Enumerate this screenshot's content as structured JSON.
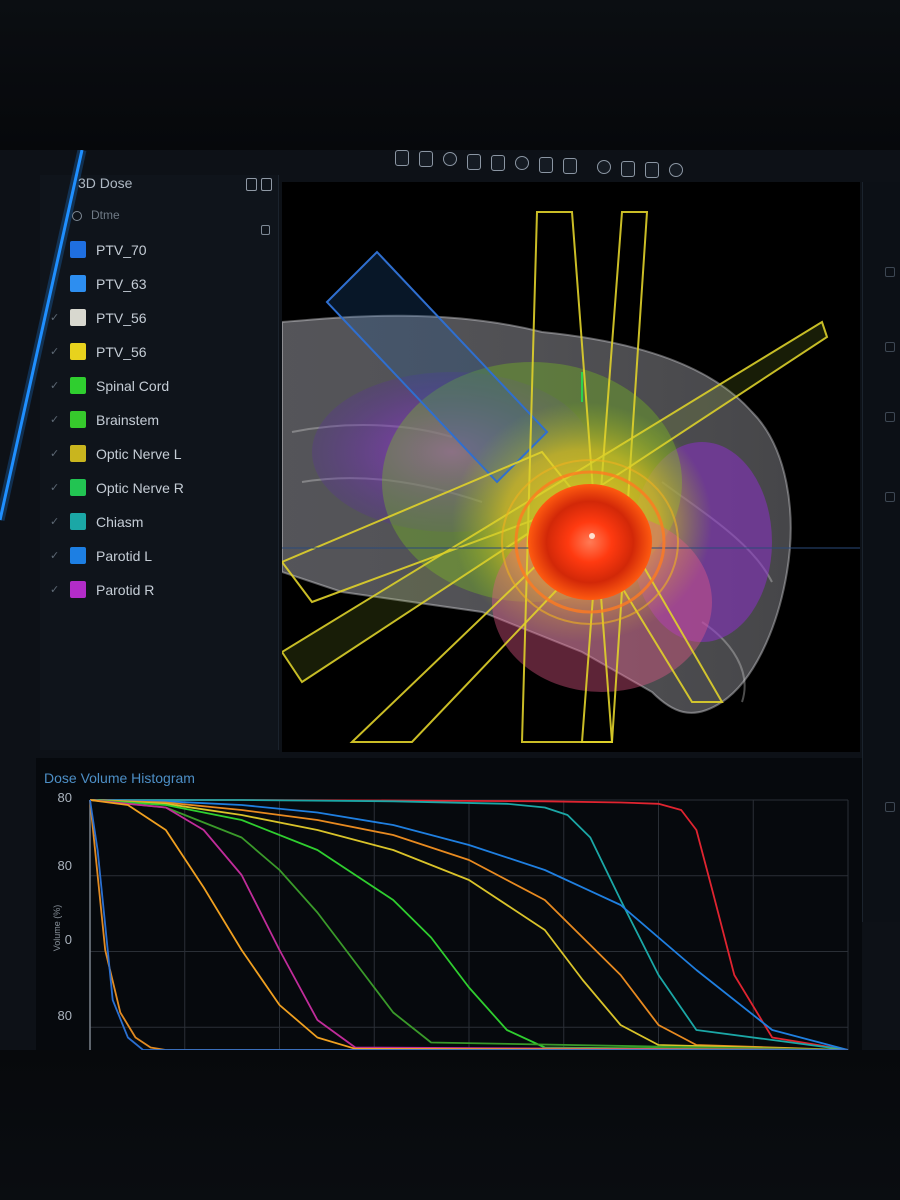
{
  "panel": {
    "title": "3D Dose",
    "filter_label": "Dtme",
    "structures": [
      {
        "label": "PTV_70",
        "color": "#1f6fe0",
        "checked": false
      },
      {
        "label": "PTV_63",
        "color": "#2d8ef0",
        "checked": false
      },
      {
        "label": "PTV_56",
        "color": "#d8d8cf",
        "checked": true
      },
      {
        "label": "PTV_56",
        "color": "#e8d21d",
        "checked": true
      },
      {
        "label": "Spinal Cord",
        "color": "#2fce2f",
        "checked": true
      },
      {
        "label": "Brainstem",
        "color": "#36c92c",
        "checked": true
      },
      {
        "label": "Optic Nerve L",
        "color": "#c9b51e",
        "checked": true
      },
      {
        "label": "Optic Nerve R",
        "color": "#22c452",
        "checked": true
      },
      {
        "label": "Chiasm",
        "color": "#1ba7a6",
        "checked": true
      },
      {
        "label": "Parotid L",
        "color": "#1d7fe3",
        "checked": true
      },
      {
        "label": "Parotid R",
        "color": "#b22cc8",
        "checked": true
      }
    ]
  },
  "toolbar": {
    "icons": [
      "window-icon",
      "rotate-icon",
      "layers-icon",
      "crop-icon",
      "reset-icon",
      "measure-icon",
      "zoom-icon",
      "pan-icon",
      "settings-icon",
      "light-icon",
      "view-icon",
      "export-icon"
    ]
  },
  "colors": {
    "accent_glow": "#1f8fff",
    "dose_hot": "#ff3a10",
    "beam": "#e0d22a"
  },
  "dvh": {
    "title": "Dose Volume Histogram",
    "y_axis_label": "Volume (%)",
    "y_ticks": [
      "80",
      "80",
      "0",
      "80"
    ]
  },
  "chart_data": {
    "type": "line",
    "title": "Dose Volume Histogram",
    "xlabel": "",
    "ylabel": "Volume (%)",
    "xlim": [
      0,
      100
    ],
    "ylim": [
      0,
      100
    ],
    "grid": true,
    "series": [
      {
        "color": "#e02430",
        "x": [
          0,
          20,
          40,
          60,
          70,
          75,
          78,
          80,
          82,
          85,
          90,
          100
        ],
        "y": [
          100,
          100,
          99.8,
          99.5,
          99,
          98.5,
          96,
          88,
          65,
          30,
          5,
          0
        ]
      },
      {
        "color": "#1ba7a6",
        "x": [
          0,
          20,
          40,
          55,
          60,
          63,
          66,
          70,
          75,
          80,
          100
        ],
        "y": [
          100,
          100,
          99.5,
          98.5,
          97,
          94,
          85,
          60,
          30,
          8,
          0
        ]
      },
      {
        "color": "#1f7fe0",
        "x": [
          0,
          10,
          20,
          30,
          40,
          50,
          60,
          70,
          80,
          90,
          100
        ],
        "y": [
          100,
          99.5,
          98,
          95,
          90,
          82,
          72,
          58,
          32,
          8,
          0
        ]
      },
      {
        "color": "#e88a20",
        "x": [
          0,
          10,
          20,
          30,
          40,
          50,
          60,
          70,
          75,
          80,
          100
        ],
        "y": [
          100,
          99,
          96,
          92,
          86,
          76,
          60,
          30,
          10,
          2,
          0
        ]
      },
      {
        "color": "#d9c32a",
        "x": [
          0,
          10,
          20,
          30,
          40,
          50,
          60,
          65,
          70,
          75,
          100
        ],
        "y": [
          100,
          98.5,
          94,
          88,
          80,
          68,
          48,
          28,
          10,
          2,
          0
        ]
      },
      {
        "color": "#2fce2f",
        "x": [
          0,
          10,
          20,
          30,
          40,
          45,
          50,
          55,
          60,
          100
        ],
        "y": [
          100,
          98,
          92,
          80,
          60,
          45,
          25,
          8,
          1,
          0
        ]
      },
      {
        "color": "#3a9a2a",
        "x": [
          0,
          10,
          20,
          25,
          30,
          35,
          40,
          45,
          100
        ],
        "y": [
          100,
          97,
          85,
          72,
          55,
          35,
          15,
          3,
          0
        ]
      },
      {
        "color": "#c02c9a",
        "x": [
          0,
          10,
          15,
          20,
          25,
          30,
          35,
          100
        ],
        "y": [
          100,
          97,
          88,
          70,
          40,
          12,
          1,
          0
        ]
      },
      {
        "color": "#f0a020",
        "x": [
          0,
          5,
          10,
          15,
          20,
          25,
          30,
          35,
          100
        ],
        "y": [
          100,
          98,
          88,
          65,
          40,
          18,
          5,
          0.5,
          0
        ]
      },
      {
        "color": "#e08a22",
        "x": [
          0,
          1,
          2,
          4,
          6,
          8,
          10,
          100
        ],
        "y": [
          100,
          70,
          40,
          15,
          5,
          1,
          0,
          0
        ]
      },
      {
        "color": "#2a6fd0",
        "x": [
          0,
          1,
          2,
          3,
          5,
          7,
          100
        ],
        "y": [
          100,
          80,
          50,
          20,
          5,
          0,
          0
        ]
      }
    ]
  }
}
